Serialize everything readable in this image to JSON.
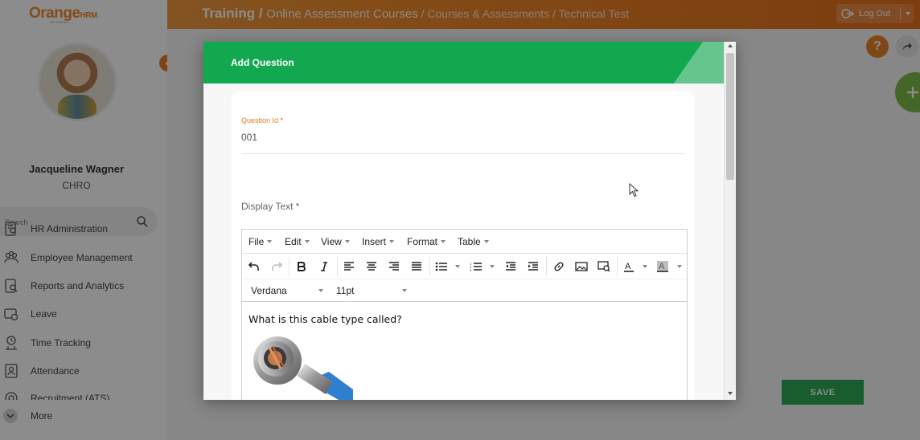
{
  "header": {
    "logo_orange": "Orange",
    "logo_hrm": "HRM",
    "logo_tagline": "HR FOR ALL",
    "breadcrumb_main": "Training",
    "breadcrumb_sep": " / ",
    "breadcrumb_course": "Online Assessment Courses",
    "breadcrumb_page": "Courses & Assessments",
    "breadcrumb_sub": "Technical Test",
    "logout_label": "Log Out"
  },
  "sidebar": {
    "user_name": "Jacqueline Wagner",
    "user_role": "CHRO",
    "search_placeholder": "Search",
    "items": [
      {
        "label": "HR Administration",
        "icon": "hr-admin-icon"
      },
      {
        "label": "Employee Management",
        "icon": "employee-icon"
      },
      {
        "label": "Reports and Analytics",
        "icon": "reports-icon"
      },
      {
        "label": "Leave",
        "icon": "leave-icon"
      },
      {
        "label": "Time Tracking",
        "icon": "time-icon"
      },
      {
        "label": "Attendance",
        "icon": "attendance-icon"
      },
      {
        "label": "Recruitment (ATS)",
        "icon": "recruitment-icon"
      }
    ],
    "more_label": "More"
  },
  "page": {
    "help_label": "?",
    "save_label": "SAVE"
  },
  "modal": {
    "title": "Add Question",
    "question_id_label": "Question Id",
    "required_mark": "*",
    "question_id_value": "001",
    "display_text_label": "Display Text *",
    "editor": {
      "menus": [
        "File",
        "Edit",
        "View",
        "Insert",
        "Format",
        "Table"
      ],
      "font_family": "Verdana",
      "font_size": "11pt",
      "content_text": "What is this cable type called?"
    }
  },
  "colors": {
    "brand_orange": "#ef8a2b",
    "modal_green": "#12a84f",
    "save_green": "#2ea853"
  }
}
